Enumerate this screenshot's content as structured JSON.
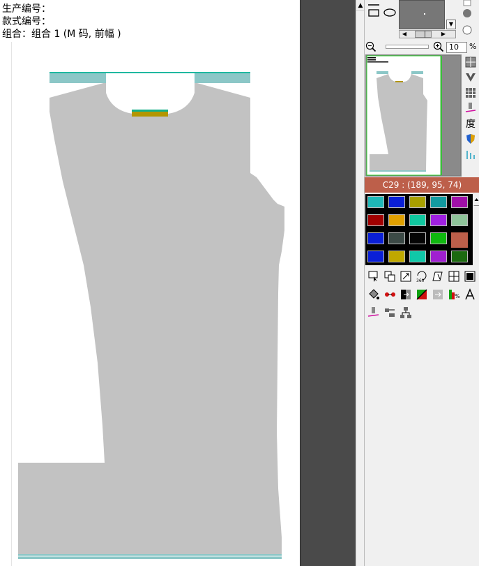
{
  "canvas": {
    "info": {
      "production_no_label": "生产编号：",
      "style_no_label": "款式编号：",
      "combo_line": "组合：组合 1 (M 码, 前幅 )"
    }
  },
  "toolbar": {
    "zoom_value": "10",
    "zoom_unit": "%"
  },
  "color_readout": "C29 : (189, 95, 74)",
  "side_tools": {
    "degree_glyph": "度"
  },
  "swatches": [
    [
      "#1fb8b8",
      "#0a1fd6",
      "#a8a000",
      "#139aa0",
      "#a010a8"
    ],
    [
      "#a00000",
      "#e0a000",
      "#10c8a0",
      "#a020e0",
      "#8fc49a"
    ],
    [
      "#0a1fd6",
      "#3c4a46",
      "#050505",
      "#10b810",
      "#bd5f4a"
    ],
    [
      "#0a1fd6",
      "#c0a800",
      "#10c8a8",
      "#a020d0",
      "#1c6a10"
    ]
  ],
  "colors": {
    "garment_body": "#c2c2c2",
    "rib_top": "#8cc7c7",
    "rib_line": "#1fb8a0",
    "neck_band_top": "#10b088",
    "neck_band_main": "#b39600",
    "selected_color": "#bd5f4a"
  }
}
